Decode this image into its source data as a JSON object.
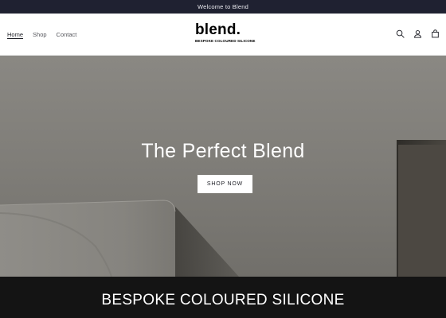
{
  "announcement": {
    "text": "Welcome to Blend"
  },
  "nav": {
    "items": [
      {
        "label": "Home",
        "active": true
      },
      {
        "label": "Shop",
        "active": false
      },
      {
        "label": "Contact",
        "active": false
      }
    ]
  },
  "logo": {
    "word": "blend.",
    "tagline": "BESPOKE COLOURED SILICONE"
  },
  "header_icons": [
    "search-icon",
    "account-icon",
    "cart-icon"
  ],
  "hero": {
    "title": "The Perfect Blend",
    "button_label": "SHOP NOW"
  },
  "banner": {
    "text": "BESPOKE COLOURED SILICONE"
  },
  "colors": {
    "announcement_bg": "#1f2131",
    "hero_wall": "#7d7b76",
    "banner_bg": "#141414",
    "button_bg": "#ffffff"
  }
}
